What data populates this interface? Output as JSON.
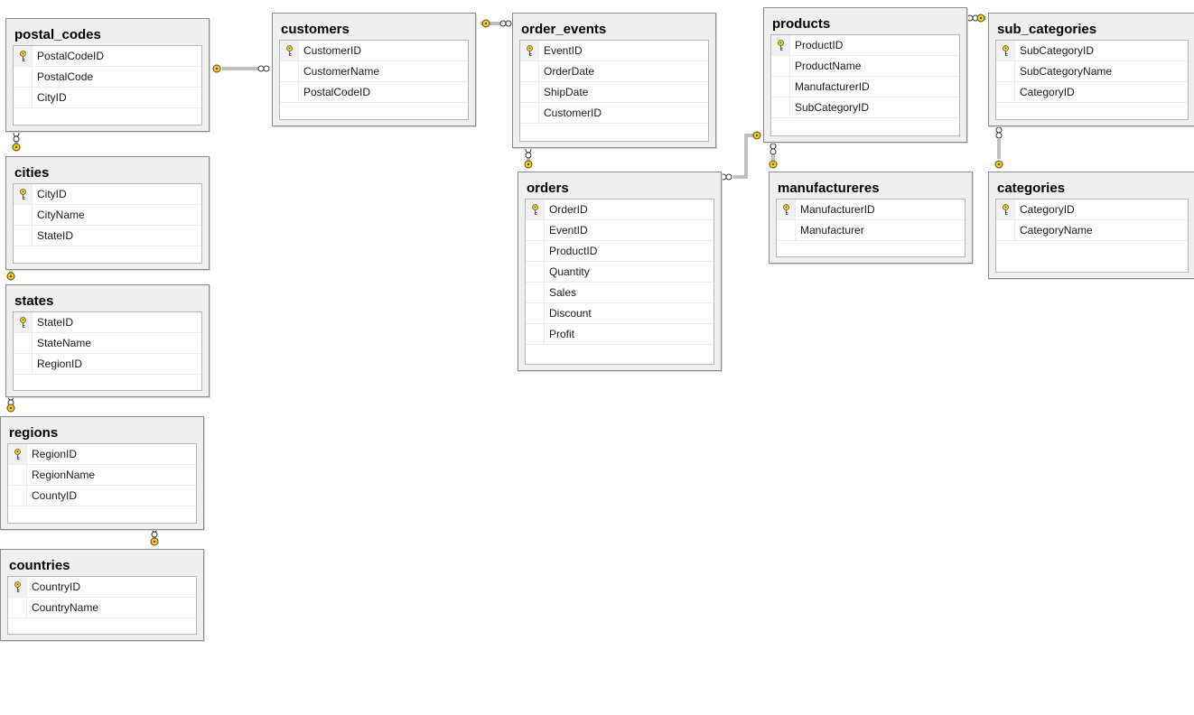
{
  "diagram": {
    "tables": [
      {
        "id": "postal_codes",
        "title": "postal_codes",
        "columns": [
          {
            "name": "PostalCodeID",
            "pk": true
          },
          {
            "name": "PostalCode",
            "pk": false
          },
          {
            "name": "CityID",
            "pk": false
          }
        ]
      },
      {
        "id": "cities",
        "title": "cities",
        "columns": [
          {
            "name": "CityID",
            "pk": true
          },
          {
            "name": "CityName",
            "pk": false
          },
          {
            "name": "StateID",
            "pk": false
          }
        ]
      },
      {
        "id": "states",
        "title": "states",
        "columns": [
          {
            "name": "StateID",
            "pk": true
          },
          {
            "name": "StateName",
            "pk": false
          },
          {
            "name": "RegionID",
            "pk": false
          }
        ]
      },
      {
        "id": "regions",
        "title": "regions",
        "columns": [
          {
            "name": "RegionID",
            "pk": true
          },
          {
            "name": "RegionName",
            "pk": false
          },
          {
            "name": "CountyID",
            "pk": false
          }
        ]
      },
      {
        "id": "countries",
        "title": "countries",
        "columns": [
          {
            "name": "CountryID",
            "pk": true
          },
          {
            "name": "CountryName",
            "pk": false
          }
        ]
      },
      {
        "id": "customers",
        "title": "customers",
        "columns": [
          {
            "name": "CustomerID",
            "pk": true
          },
          {
            "name": "CustomerName",
            "pk": false
          },
          {
            "name": "PostalCodeID",
            "pk": false
          }
        ]
      },
      {
        "id": "order_events",
        "title": "order_events",
        "columns": [
          {
            "name": "EventID",
            "pk": true
          },
          {
            "name": "OrderDate",
            "pk": false
          },
          {
            "name": "ShipDate",
            "pk": false
          },
          {
            "name": "CustomerID",
            "pk": false
          }
        ]
      },
      {
        "id": "orders",
        "title": "orders",
        "columns": [
          {
            "name": "OrderID",
            "pk": true
          },
          {
            "name": "EventID",
            "pk": false
          },
          {
            "name": "ProductID",
            "pk": false
          },
          {
            "name": "Quantity",
            "pk": false
          },
          {
            "name": "Sales",
            "pk": false
          },
          {
            "name": "Discount",
            "pk": false
          },
          {
            "name": "Profit",
            "pk": false
          }
        ]
      },
      {
        "id": "products",
        "title": "products",
        "columns": [
          {
            "name": "ProductID",
            "pk": true
          },
          {
            "name": "ProductName",
            "pk": false
          },
          {
            "name": "ManufacturerID",
            "pk": false
          },
          {
            "name": "SubCategoryID",
            "pk": false
          }
        ]
      },
      {
        "id": "manufactureres",
        "title": "manufactureres",
        "columns": [
          {
            "name": "ManufacturerID",
            "pk": true
          },
          {
            "name": "Manufacturer",
            "pk": false
          }
        ]
      },
      {
        "id": "sub_categories",
        "title": "sub_categories",
        "columns": [
          {
            "name": "SubCategoryID",
            "pk": true
          },
          {
            "name": "SubCategoryName",
            "pk": false
          },
          {
            "name": "CategoryID",
            "pk": false
          }
        ]
      },
      {
        "id": "categories",
        "title": "categories",
        "columns": [
          {
            "name": "CategoryID",
            "pk": true
          },
          {
            "name": "CategoryName",
            "pk": false
          }
        ]
      }
    ],
    "relationships": [
      {
        "from": "customers",
        "to": "postal_codes"
      },
      {
        "from": "customers",
        "to": "order_events"
      },
      {
        "from": "postal_codes",
        "to": "cities"
      },
      {
        "from": "cities",
        "to": "states"
      },
      {
        "from": "states",
        "to": "regions"
      },
      {
        "from": "regions",
        "to": "countries"
      },
      {
        "from": "order_events",
        "to": "orders"
      },
      {
        "from": "orders",
        "to": "products"
      },
      {
        "from": "products",
        "to": "manufactureres"
      },
      {
        "from": "products",
        "to": "sub_categories"
      },
      {
        "from": "sub_categories",
        "to": "categories"
      }
    ],
    "colors": {
      "table_header": "#efefef",
      "table_border": "#8c8c8c",
      "key_fill": "#ffd200",
      "connector": "#808080"
    },
    "icons": {
      "primary_key": "key-icon",
      "relationship_end": "infinity-icon"
    }
  }
}
